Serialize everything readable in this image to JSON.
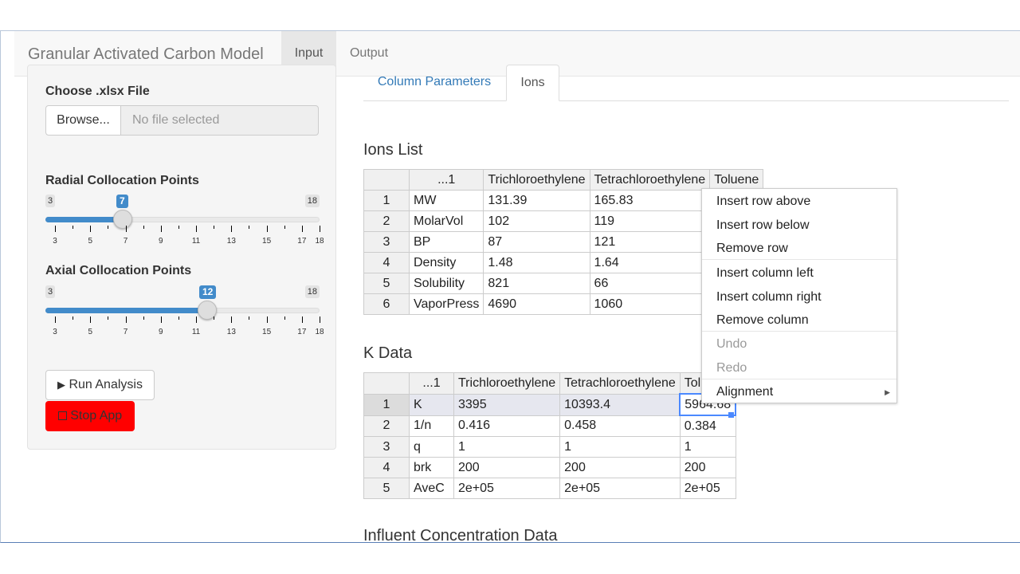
{
  "app": {
    "brand": "Granular Activated Carbon Model",
    "nav_tabs": [
      {
        "label": "Input",
        "active": true
      },
      {
        "label": "Output",
        "active": false
      }
    ]
  },
  "sidebar": {
    "file_label": "Choose .xlsx File",
    "browse_label": "Browse...",
    "file_placeholder": "No file selected",
    "radial": {
      "label": "Radial Collocation Points",
      "min": "3",
      "max": "18",
      "value": "7",
      "ticks": [
        "3",
        "5",
        "7",
        "9",
        "11",
        "13",
        "15",
        "17",
        "18"
      ]
    },
    "axial": {
      "label": "Axial Collocation Points",
      "min": "3",
      "max": "18",
      "value": "12",
      "ticks": [
        "3",
        "5",
        "7",
        "9",
        "11",
        "13",
        "15",
        "17",
        "18"
      ]
    },
    "run_label": "Run Analysis",
    "stop_label": "Stop App",
    "stop_color": "#ff0000"
  },
  "main": {
    "tabs": [
      {
        "label": "Column Parameters",
        "active": false
      },
      {
        "label": "Ions",
        "active": true
      }
    ],
    "ions_title": "Ions List",
    "ions_table": {
      "headers": [
        "",
        "...1",
        "Trichloroethylene",
        "Tetrachloroethylene",
        "Toluene"
      ],
      "rows": [
        [
          "1",
          "MW",
          "131.39",
          "165.83"
        ],
        [
          "2",
          "MolarVol",
          "102",
          "119"
        ],
        [
          "3",
          "BP",
          "87",
          "121"
        ],
        [
          "4",
          "Density",
          "1.48",
          "1.64"
        ],
        [
          "5",
          "Solubility",
          "821",
          "66"
        ],
        [
          "6",
          "VaporPress",
          "4690",
          "1060"
        ]
      ]
    },
    "k_title": "K Data",
    "k_table": {
      "headers": [
        "",
        "...1",
        "Trichloroethylene",
        "Tetrachloroethylene",
        "Tolu"
      ],
      "rows": [
        [
          "1",
          "K",
          "3395",
          "10393.4",
          "5964.68"
        ],
        [
          "2",
          "1/n",
          "0.416",
          "0.458",
          "0.384"
        ],
        [
          "3",
          "q",
          "1",
          "1",
          "1"
        ],
        [
          "4",
          "brk",
          "200",
          "200",
          "200"
        ],
        [
          "5",
          "AveC",
          "2e+05",
          "2e+05",
          "2e+05"
        ]
      ]
    },
    "influent_title": "Influent Concentration Data"
  },
  "context_menu": {
    "items": [
      {
        "label": "Insert row above",
        "enabled": true
      },
      {
        "label": "Insert row below",
        "enabled": true
      },
      {
        "label": "Remove row",
        "enabled": true
      },
      {
        "label": "Insert column left",
        "enabled": true
      },
      {
        "label": "Insert column right",
        "enabled": true
      },
      {
        "label": "Remove column",
        "enabled": true
      },
      {
        "label": "Undo",
        "enabled": false
      },
      {
        "label": "Redo",
        "enabled": false
      },
      {
        "label": "Alignment",
        "enabled": true,
        "submenu": true
      }
    ],
    "submenu_arrow": "▶"
  }
}
